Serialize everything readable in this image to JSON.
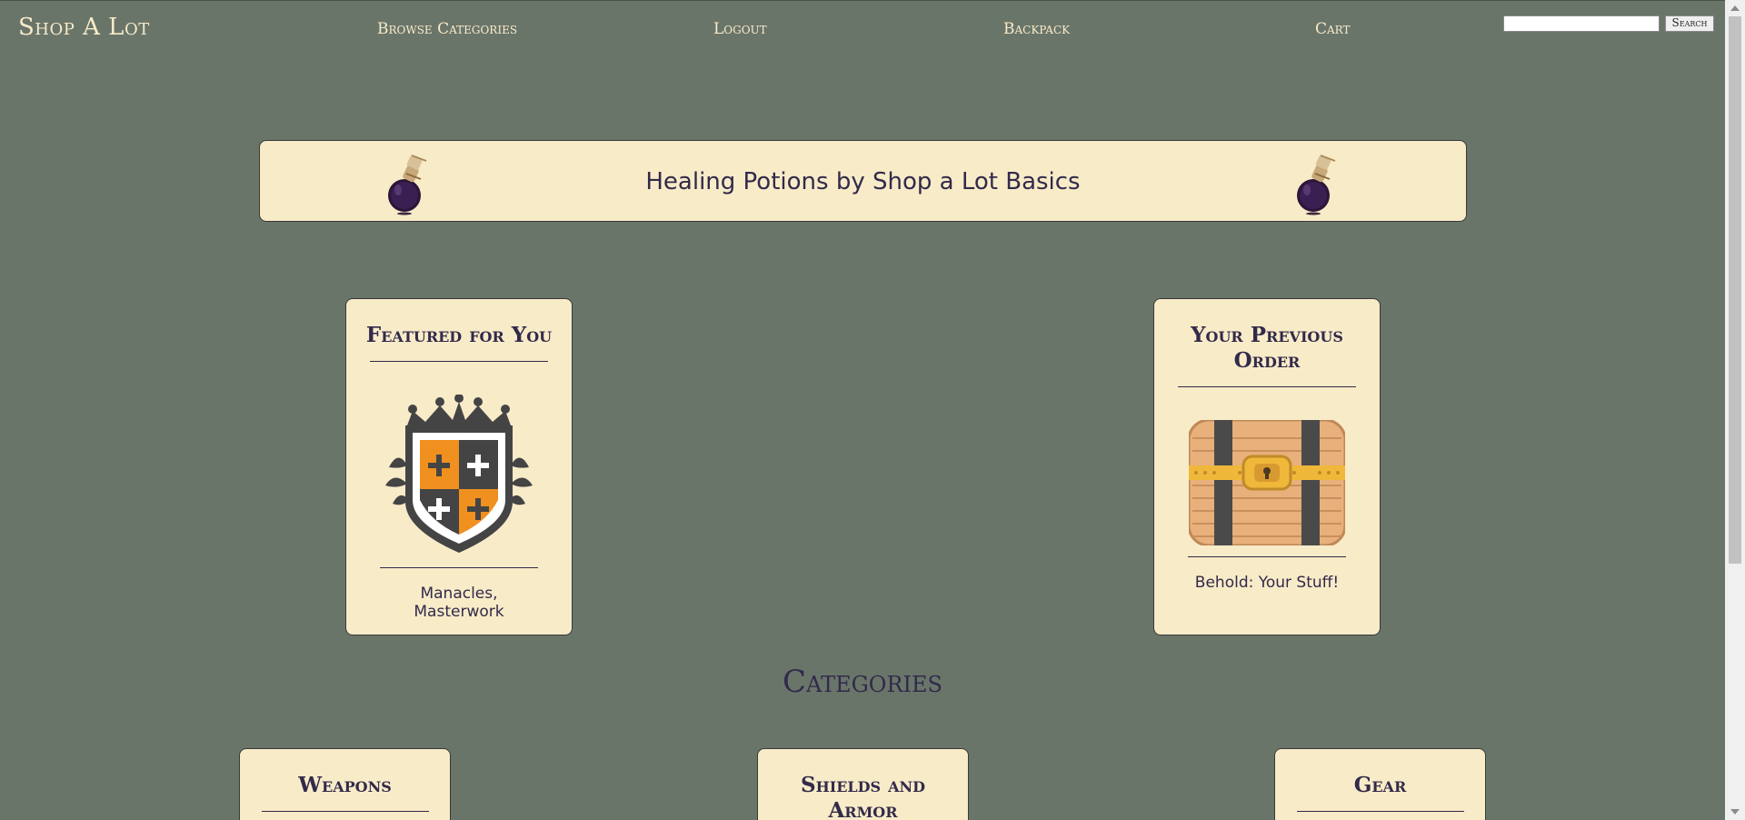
{
  "nav": {
    "brand": "Shop A Lot",
    "links": [
      "Browse Categories",
      "Logout",
      "Backpack",
      "Cart"
    ],
    "search": {
      "value": "",
      "placeholder": "",
      "button": "Search"
    }
  },
  "banner": {
    "text": "Healing Potions by Shop a Lot Basics"
  },
  "featured": {
    "title": "Featured for You",
    "caption_line1": "Manacles,",
    "caption_line2": "Masterwork"
  },
  "previous": {
    "title_line1": "Your Previous",
    "title_line2": "Order",
    "caption": "Behold: Your Stuff!"
  },
  "categories": {
    "title": "Categories",
    "items": [
      {
        "line1": "Weapons",
        "line2": ""
      },
      {
        "line1": "Shields and",
        "line2": "Armor"
      },
      {
        "line1": "Gear",
        "line2": ""
      }
    ]
  },
  "colors": {
    "background": "#6a756a",
    "card": "#f8ebc8",
    "text": "#322a4a",
    "nav_text": "#f8ebc8"
  }
}
